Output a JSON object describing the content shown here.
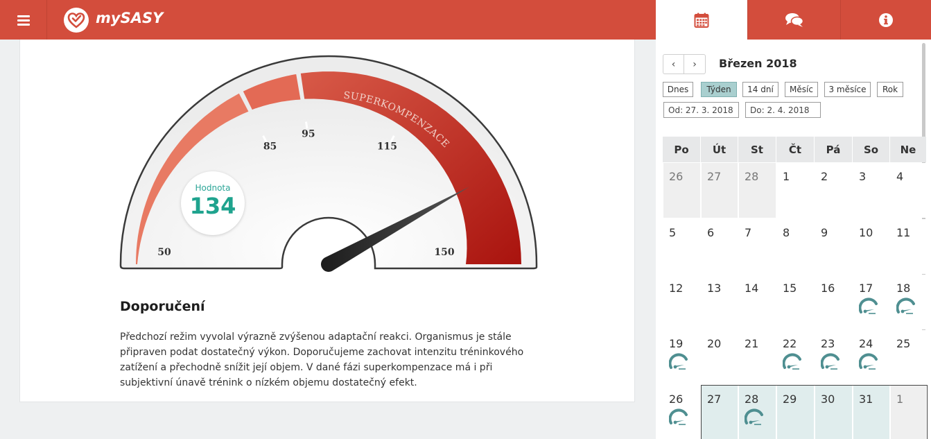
{
  "app": {
    "name": "mySASY",
    "menu_icon": "hamburger-menu-icon",
    "logo_icon": "heart-check-icon",
    "accent_color": "#d34d3c"
  },
  "tabs": [
    {
      "icon": "calendar-icon",
      "active": true
    },
    {
      "icon": "chat-icon",
      "active": false
    },
    {
      "icon": "info-icon",
      "active": false
    }
  ],
  "gauge": {
    "value_label": "Hodnota",
    "value": "134",
    "value_number": 134,
    "zone_label": "SUPERKOMPENZACE",
    "scale_min": 50,
    "scale_max": 150,
    "ticks": [
      "50",
      "85",
      "95",
      "115",
      "150"
    ]
  },
  "recommendation": {
    "title": "Doporučení",
    "text": "Předchozí režim vyvolal výrazně zvýšenou adaptační reakci. Organismus je stále připraven podat dostatečný výkon. Doporučujeme zachovat intenzitu tréninkového zatížení a přechodně snížit její objem. V dané fázi superkompenzace má i při subjektivní únavě trénink o nízkém objemu dostatečný efekt."
  },
  "calendar": {
    "month_title": "Březen 2018",
    "prev_label": "‹",
    "next_label": "›",
    "ranges": [
      "Dnes",
      "Týden",
      "14 dní",
      "Měsíc",
      "3 měsíce",
      "Rok"
    ],
    "active_range": "Týden",
    "from": "Od: 27. 3. 2018",
    "to": "Do: 2. 4. 2018",
    "weekdays": [
      "Po",
      "Út",
      "St",
      "Čt",
      "Pá",
      "So",
      "Ne"
    ],
    "weeks": [
      [
        "26",
        "27",
        "28",
        "1",
        "2",
        "3",
        "4"
      ],
      [
        "5",
        "6",
        "7",
        "8",
        "9",
        "10",
        "11"
      ],
      [
        "12",
        "13",
        "14",
        "15",
        "16",
        "17",
        "18"
      ],
      [
        "19",
        "20",
        "21",
        "22",
        "23",
        "24",
        "25"
      ],
      [
        "26",
        "27",
        "28",
        "29",
        "30",
        "31",
        "1"
      ]
    ],
    "outside_month": [
      "0-0",
      "0-1",
      "0-2",
      "4-6"
    ],
    "selected_week": [
      "4-1",
      "4-2",
      "4-3",
      "4-4",
      "4-5"
    ],
    "gauge_days": [
      "2-5",
      "2-6",
      "3-0",
      "3-3",
      "3-4",
      "3-5",
      "4-0",
      "4-2"
    ],
    "gauge_icon": "mini-gauge-icon",
    "gauge_color": "#4f8f91"
  }
}
